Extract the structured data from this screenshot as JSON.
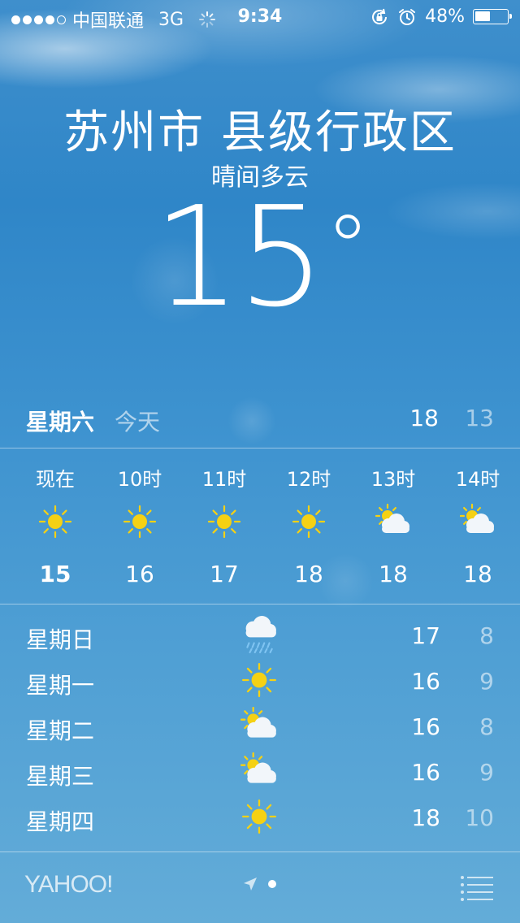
{
  "status_bar": {
    "signal_dots_filled": 4,
    "signal_dots_total": 5,
    "carrier": "中国联通",
    "network": "3G",
    "time": "9:34",
    "battery_percent": "48%",
    "battery_level": 0.48
  },
  "location": {
    "city": "苏州市 县级行政区",
    "condition": "晴间多云",
    "temperature": "15"
  },
  "today": {
    "day": "星期六",
    "label": "今天",
    "high": "18",
    "low": "13"
  },
  "hourly": [
    {
      "time": "现在",
      "icon": "sun-icon",
      "temp": "15"
    },
    {
      "time": "10时",
      "icon": "sun-icon",
      "temp": "16"
    },
    {
      "time": "11时",
      "icon": "sun-icon",
      "temp": "17"
    },
    {
      "time": "12时",
      "icon": "sun-icon",
      "temp": "18"
    },
    {
      "time": "13时",
      "icon": "partly-cloudy-icon",
      "temp": "18"
    },
    {
      "time": "14时",
      "icon": "partly-cloudy-icon",
      "temp": "18"
    }
  ],
  "daily": [
    {
      "day": "星期日",
      "icon": "rain-icon",
      "high": "17",
      "low": "8"
    },
    {
      "day": "星期一",
      "icon": "sun-icon",
      "high": "16",
      "low": "9"
    },
    {
      "day": "星期二",
      "icon": "partly-cloudy-icon",
      "high": "16",
      "low": "8"
    },
    {
      "day": "星期三",
      "icon": "partly-cloudy-icon",
      "high": "16",
      "low": "9"
    },
    {
      "day": "星期四",
      "icon": "sun-icon",
      "high": "18",
      "low": "10"
    }
  ],
  "footer": {
    "brand": "YAHOO!"
  },
  "colors": {
    "sun": "#f5d114",
    "cloud": "#f2f6fa",
    "rain": "#7fc4f2"
  }
}
